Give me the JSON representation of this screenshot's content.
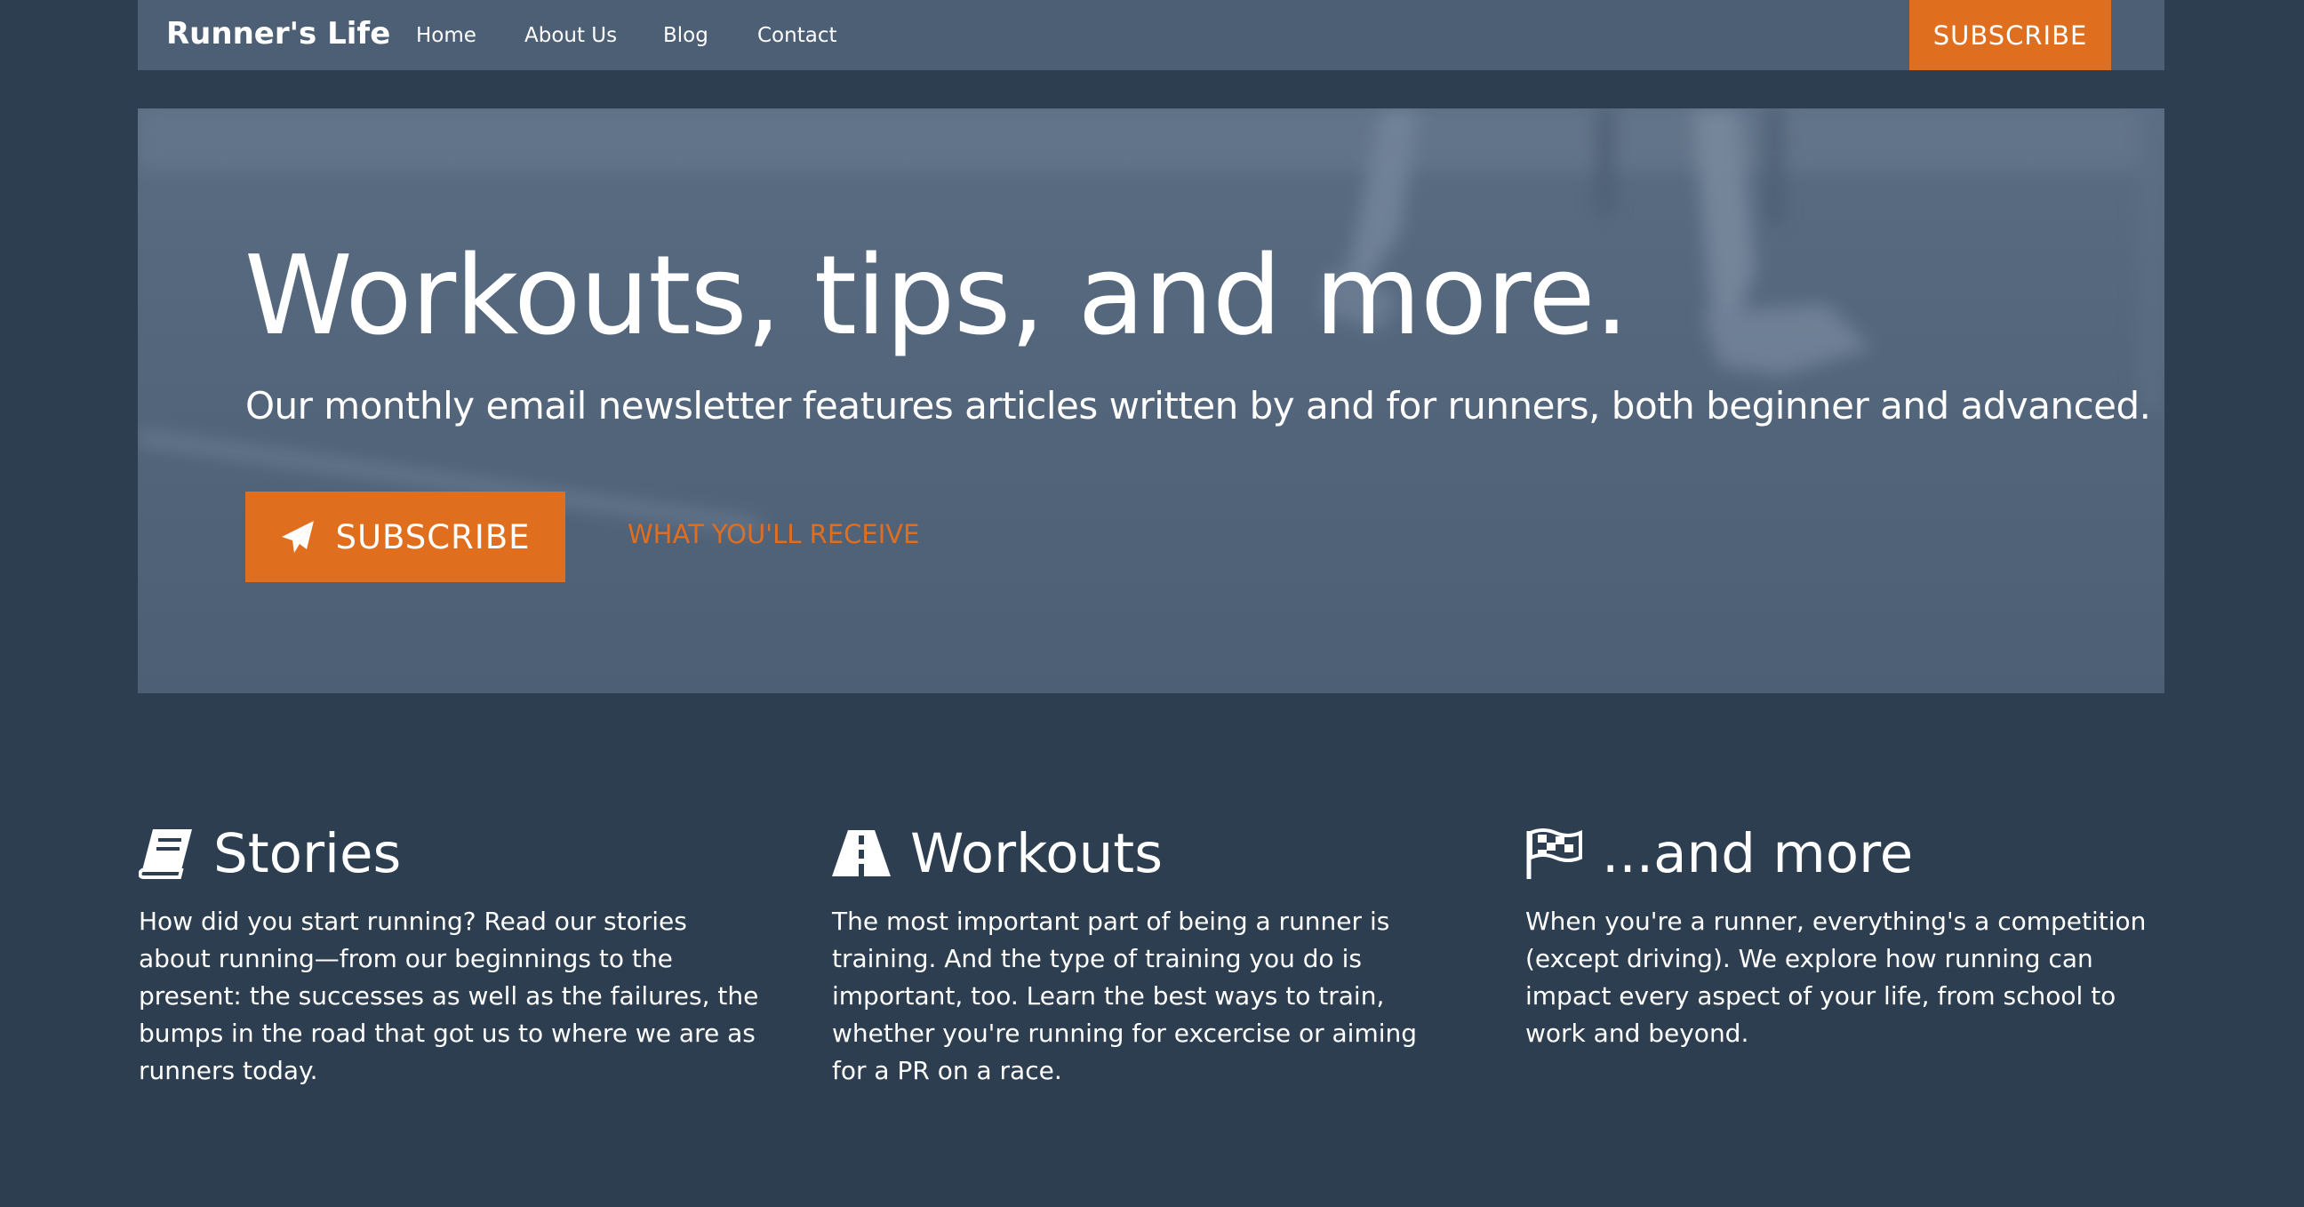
{
  "navbar": {
    "brand": "Runner's Life",
    "links": [
      "Home",
      "About Us",
      "Blog",
      "Contact"
    ],
    "subscribe_label": "SUBSCRIBE"
  },
  "hero": {
    "title": "Workouts, tips, and more.",
    "subtitle": "Our monthly email newsletter features articles written by and for runners, both beginner and advanced.",
    "subscribe_label": "SUBSCRIBE",
    "subscribe_icon": "paper-plane-icon",
    "receive_link": "WHAT YOU'LL RECEIVE"
  },
  "features": [
    {
      "icon": "book-icon",
      "title": "Stories",
      "body": "How did you start running? Read our stories about running—from our beginnings to the present: the successes as well as the failures, the bumps in the road that got us to where we are as runners today."
    },
    {
      "icon": "road-icon",
      "title": "Workouts",
      "body": "The most important part of being a runner is training. And the type of training you do is important, too. Learn the best ways to train, whether you're running for excercise or aiming for a PR on a race."
    },
    {
      "icon": "flag-checkered-icon",
      "title": "...and more",
      "body": "When you're a runner, everything's a competition (except driving). We explore how running can impact every aspect of your life, from school to work and beyond."
    }
  ],
  "colors": {
    "background": "#2c3e50",
    "navbar": "#4c5f75",
    "accent": "#e06e1f",
    "text": "#ffffff"
  }
}
